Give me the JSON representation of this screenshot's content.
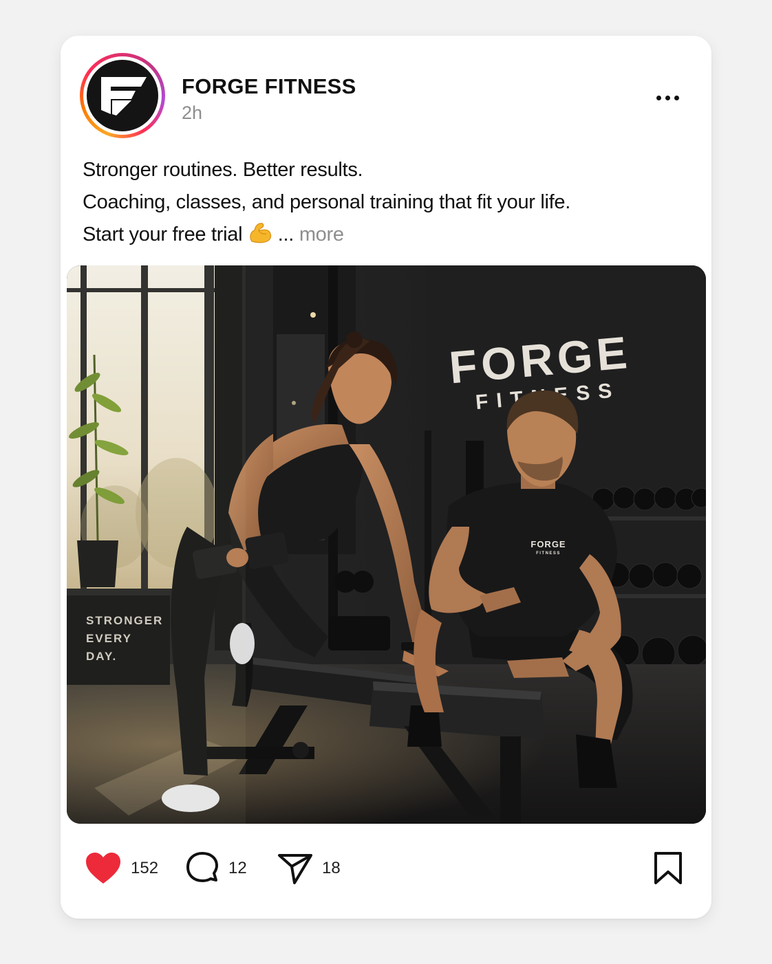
{
  "post": {
    "account_name": "FORGE FITNESS",
    "time_ago": "2h",
    "caption": {
      "line1": "Stronger routines. Better results.",
      "line2": "Coaching, classes, and personal training that fit your life.",
      "line3": "Start your free trial",
      "emoji": "flexed-biceps",
      "ellipsis": "...",
      "more_label": "more"
    },
    "image": {
      "wall_logo_main": "FORGE",
      "wall_logo_sub": "FITNESS",
      "box_text_1": "STRONGER",
      "box_text_2": "EVERY",
      "box_text_3": "DAY.",
      "shirt_logo_main": "FORGE",
      "shirt_logo_sub": "FITNESS"
    },
    "actions": {
      "likes": "152",
      "comments": "12",
      "shares": "18"
    }
  },
  "icons": {
    "more": "more-horizontal-icon",
    "like": "heart-icon",
    "comment": "comment-bubble-icon",
    "share": "paper-plane-icon",
    "save": "bookmark-icon"
  },
  "colors": {
    "like_red": "#ed2a3a",
    "muted_text": "#8e8e8e",
    "avatar_bg": "#141414"
  }
}
